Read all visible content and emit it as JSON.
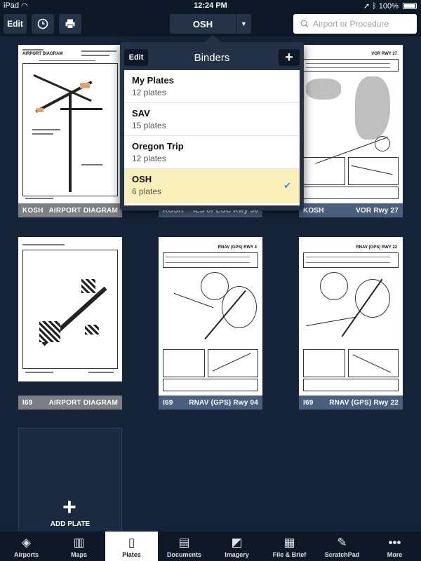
{
  "status_bar": {
    "device": "iPad",
    "time": "12:24 PM",
    "battery": "100%"
  },
  "toolbar": {
    "edit_label": "Edit",
    "binder_label": "OSH",
    "search_placeholder": "Airport or Procedure"
  },
  "plates": [
    {
      "airport": "KOSH",
      "name": "AIRPORT DIAGRAM"
    },
    {
      "airport": "KOSH",
      "name": "ILS or LOC Rwy 36"
    },
    {
      "airport": "KOSH",
      "name": "VOR Rwy 27"
    },
    {
      "airport": "I69",
      "name": "AIRPORT DIAGRAM"
    },
    {
      "airport": "I69",
      "name": "RNAV (GPS) Rwy 04"
    },
    {
      "airport": "I69",
      "name": "RNAV (GPS) Rwy 22"
    }
  ],
  "add_plate_label": "ADD PLATE",
  "binders_popover": {
    "title": "Binders",
    "edit_label": "Edit",
    "add_label": "+",
    "items": [
      {
        "name": "My Plates",
        "count": "12 plates",
        "selected": false
      },
      {
        "name": "SAV",
        "count": "15 plates",
        "selected": false
      },
      {
        "name": "Oregon Trip",
        "count": "12 plates",
        "selected": false
      },
      {
        "name": "OSH",
        "count": "6 plates",
        "selected": true
      }
    ]
  },
  "tabs": [
    {
      "label": "Airports",
      "icon": "compass-icon",
      "active": false
    },
    {
      "label": "Maps",
      "icon": "map-icon",
      "active": false
    },
    {
      "label": "Plates",
      "icon": "plate-icon",
      "active": true
    },
    {
      "label": "Documents",
      "icon": "documents-icon",
      "active": false
    },
    {
      "label": "Imagery",
      "icon": "imagery-icon",
      "active": false
    },
    {
      "label": "File & Brief",
      "icon": "clipboard-icon",
      "active": false
    },
    {
      "label": "ScratchPad",
      "icon": "pen-icon",
      "active": false
    },
    {
      "label": "More",
      "icon": "more-icon",
      "active": false
    }
  ]
}
